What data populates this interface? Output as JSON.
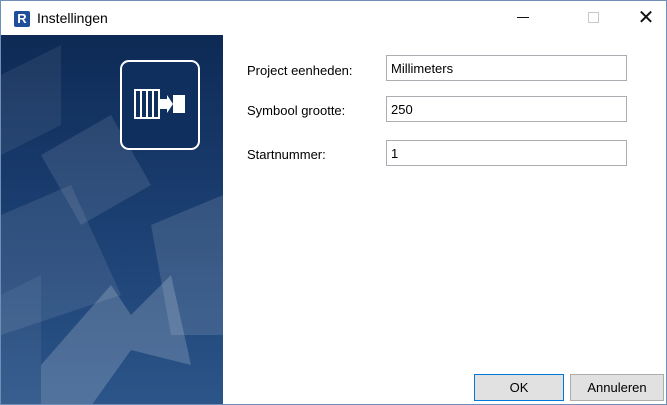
{
  "window": {
    "title": "Instellingen",
    "app_icon_letter": "R"
  },
  "titlebar_controls": {
    "minimize_icon": "minimize-icon",
    "maximize_icon": "maximize-icon",
    "close_icon": "close-icon"
  },
  "form": {
    "fields": [
      {
        "label": "Project eenheden:",
        "value": "Millimeters"
      },
      {
        "label": "Symbool grootte:",
        "value": "250"
      },
      {
        "label": "Startnummer:",
        "value": "1"
      }
    ]
  },
  "buttons": {
    "ok_label": "OK",
    "cancel_label": "Annuleren"
  },
  "colors": {
    "banner_dark": "#0d2a55",
    "banner_light": "#2c5589",
    "app_icon": "#1f4f9a",
    "ok_border": "#0078d7"
  }
}
